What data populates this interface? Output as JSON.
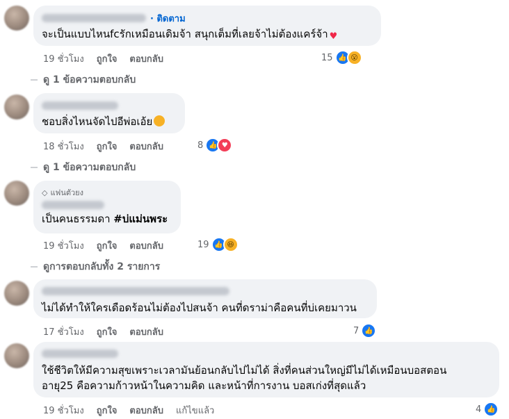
{
  "comments": [
    {
      "follow_label": "· ติดตาม",
      "text": "จะเป็นแบบไหนfcรักเหมือนเดิมจ้า สนุกเต็มที่เลยจ้าไม่ต้องแคร์จ้า",
      "time": "19 ชั่วโมง",
      "like_label": "ถูกใจ",
      "reply_label": "ตอบกลับ",
      "reaction_count": "15",
      "reaction_icons": [
        "like-icon",
        "wow-icon"
      ],
      "view_replies": "ดู 1 ข้อความตอบกลับ"
    },
    {
      "text": "ชอบสิ่งไหนจัดไปอีพ่อเอ้ย",
      "time": "18 ชั่วโมง",
      "like_label": "ถูกใจ",
      "reply_label": "ตอบกลับ",
      "reaction_count": "8",
      "reaction_icons": [
        "like-icon",
        "love-icon"
      ],
      "view_replies": "ดู 1 ข้อความตอบกลับ"
    },
    {
      "badge": "แฟนตัวยง",
      "text_plain": "เป็นคนธรรมดา ",
      "hashtag": "#บ่แม่นพระ",
      "time": "19 ชั่วโมง",
      "like_label": "ถูกใจ",
      "reply_label": "ตอบกลับ",
      "reaction_count": "19",
      "reaction_icons": [
        "like-icon",
        "haha-icon"
      ],
      "view_replies": "ดูการตอบกลับทั้ง 2 รายการ"
    },
    {
      "text": "ไม่ได้ทำให้ใครเดือดร้อนไม่ต้องไปสนจ้า คนที่ดราม่าคือคนที่บ่เคยมาวน",
      "time": "17 ชั่วโมง",
      "like_label": "ถูกใจ",
      "reply_label": "ตอบกลับ",
      "reaction_count": "7",
      "reaction_icons": [
        "like-icon"
      ]
    },
    {
      "text_line1": "ใช้ชีวิตให้มีความสุขเพราะเวลามันย้อนกลับไปไม่ได้ สิ่งที่คนส่วนใหญ่มีไม่ได้เหมือนบอสตอน",
      "text_line2": "อายุ25 คือความก้าวหน้าในความคิด และหน้าที่การงาน บอสเก่งที่สุดแล้ว",
      "time": "19 ชั่วโมง",
      "like_label": "ถูกใจ",
      "reply_label": "ตอบกลับ",
      "edited_label": "แก้ไขแล้ว",
      "reaction_count": "4",
      "reaction_icons": [
        "like-icon"
      ]
    }
  ],
  "colors": {
    "bubble": "#f0f2f5",
    "secondary_text": "#65676b",
    "link_blue": "#0064d1",
    "like_blue": "#1877f2"
  }
}
